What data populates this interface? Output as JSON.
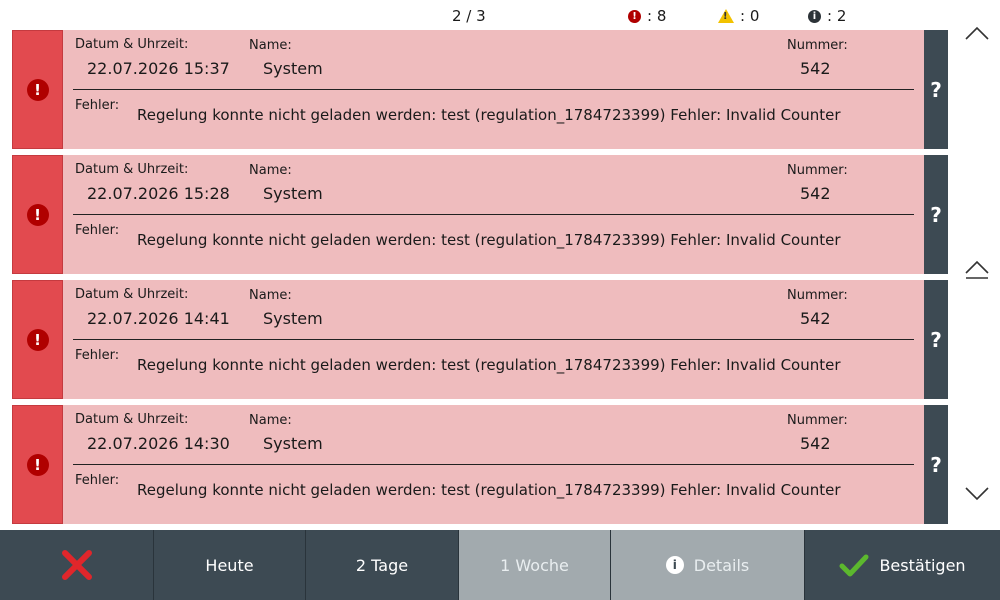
{
  "header": {
    "page": "2 / 3",
    "error_count": ": 8",
    "warning_count": ": 0",
    "info_count": ": 2",
    "error_icon_glyph": "!",
    "warning_icon_glyph": "!",
    "info_icon_glyph": "i"
  },
  "labels": {
    "datetime": "Datum & Uhrzeit:",
    "name": "Name:",
    "number": "Nummer:",
    "error": "Fehler:",
    "help": "?",
    "err_glyph": "!"
  },
  "entries": [
    {
      "datetime": "22.07.2026 15:37",
      "name": "System",
      "number": "542",
      "message": "Regelung konnte nicht geladen werden: test (regulation_1784723399) Fehler: Invalid Counter"
    },
    {
      "datetime": "22.07.2026 15:28",
      "name": "System",
      "number": "542",
      "message": "Regelung konnte nicht geladen werden: test (regulation_1784723399) Fehler: Invalid Counter"
    },
    {
      "datetime": "22.07.2026 14:41",
      "name": "System",
      "number": "542",
      "message": "Regelung konnte nicht geladen werden: test (regulation_1784723399) Fehler: Invalid Counter"
    },
    {
      "datetime": "22.07.2026 14:30",
      "name": "System",
      "number": "542",
      "message": "Regelung konnte nicht geladen werden: test (regulation_1784723399) Fehler: Invalid Counter"
    }
  ],
  "toolbar": {
    "today": "Heute",
    "two_days": "2 Tage",
    "one_week": "1 Woche",
    "details": "Details",
    "confirm": "Bestätigen",
    "info_glyph": "i"
  },
  "colors": {
    "error_red": "#e24a4f",
    "entry_bg": "#efbcbe",
    "dark_panel": "#3d4a53",
    "inactive_button": "#a2aaae",
    "confirm_green": "#5cb82e",
    "warning_yellow": "#f2c200"
  },
  "icons": [
    "error-icon",
    "warning-icon",
    "info-icon",
    "chevron-up-icon",
    "scroll-top-icon",
    "chevron-down-icon",
    "close-icon",
    "check-icon"
  ]
}
